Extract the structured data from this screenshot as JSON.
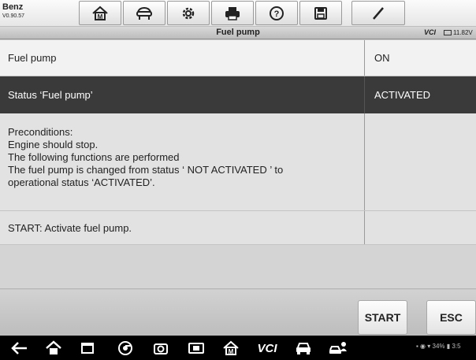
{
  "header": {
    "brand": "Benz",
    "version": "V0.90.57",
    "toolbar_icons": [
      "home-icon",
      "vehicle-lift-icon",
      "gear-icon",
      "printer-icon",
      "help-icon",
      "save-icon",
      "pen-icon"
    ]
  },
  "titlebar": {
    "title": "Fuel pump",
    "vci_label": "VCI",
    "battery_voltage": "11.82V"
  },
  "rows": [
    {
      "label": "Fuel pump",
      "value": "ON"
    },
    {
      "label": "Status ‘Fuel pump’",
      "value": "ACTIVATED"
    }
  ],
  "preconditions": {
    "lines": [
      "Preconditions:",
      "Engine should stop.",
      "The following functions are performed",
      "The fuel pump is changed from status ‘ NOT ACTIVATED ’ to",
      "operational status ‘ACTIVATED’."
    ]
  },
  "start_row": {
    "label": "START: Activate fuel pump."
  },
  "actions": {
    "start_label": "START",
    "esc_label": "ESC"
  },
  "system_bar": {
    "vci_text": "VCI",
    "battery_percent": "34%",
    "time": "3:5"
  },
  "colors": {
    "selected_row": "#3a3a3a",
    "row_background": "#f2f2f2",
    "system_bar": "#000000"
  }
}
